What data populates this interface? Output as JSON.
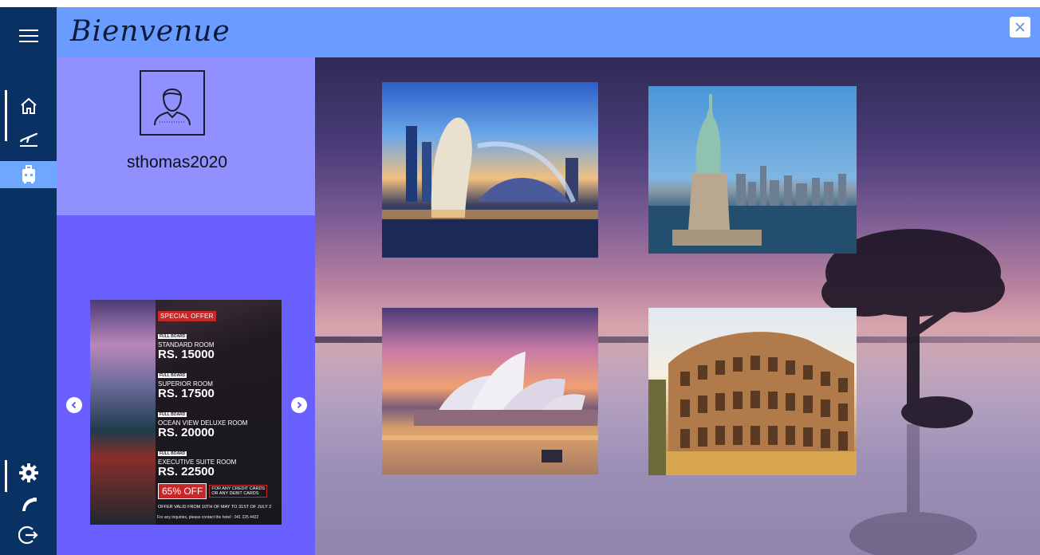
{
  "window": {
    "title": "Bienvenue",
    "close_icon": "close-icon"
  },
  "nav": {
    "items": [
      {
        "name": "menu",
        "icon": "hamburger-icon"
      },
      {
        "name": "home",
        "icon": "home-icon"
      },
      {
        "name": "flights",
        "icon": "airplane-departure-icon"
      },
      {
        "name": "hotel",
        "icon": "luggage-icon",
        "active": true
      },
      {
        "name": "settings",
        "icon": "gear-icon"
      },
      {
        "name": "contact",
        "icon": "phone-icon"
      },
      {
        "name": "logout",
        "icon": "logout-icon"
      }
    ],
    "colors": {
      "bar": "#0a3164",
      "active": "#6fa7ff"
    }
  },
  "profile": {
    "username": "sthomas2020",
    "avatar_icon": "user-avatar-icon"
  },
  "offer": {
    "tag": "SPECIAL OFFER",
    "rooms": [
      {
        "badge": "FULL BOARD",
        "name": "STANDARD ROOM",
        "price": "RS. 15000"
      },
      {
        "badge": "FULL BOARD",
        "name": "SUPERIOR ROOM",
        "price": "RS. 17500"
      },
      {
        "badge": "FULL BOARD",
        "name": "OCEAN VIEW DELUXE ROOM",
        "price": "RS. 20000"
      },
      {
        "badge": "FULL BOARD",
        "name": "EXECUTIVE SUITE ROOM",
        "price": "RS. 22500"
      }
    ],
    "discount": "65% OFF",
    "discount_note_1": "FOR ANY CREDIT CARDS",
    "discount_note_2": "OR ANY DEBIT CARDS",
    "validity": "OFFER VALID FROM 10TH OF MAY TO 31ST OF JULY 2",
    "contact": "For any inquiries, please contact the hotel : 041 225 4422",
    "prev_icon": "chevron-left-icon",
    "next_icon": "chevron-right-icon"
  },
  "destinations": [
    {
      "place": "Singapore Merlion"
    },
    {
      "place": "Statue of Liberty"
    },
    {
      "place": "Sydney Opera House"
    },
    {
      "place": "Colosseum"
    }
  ],
  "colors": {
    "titlebar": "#6a9cff",
    "profile_panel": "#9090ff",
    "offers_panel": "#6a60ff",
    "offer_red": "#c62828"
  }
}
